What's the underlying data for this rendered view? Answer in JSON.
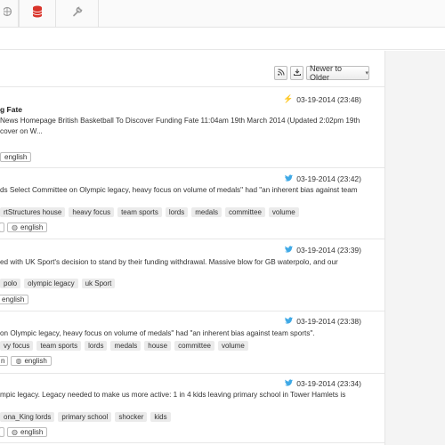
{
  "topbar": {
    "icons": [
      "globe-icon",
      "database-icon",
      "wrench-icon"
    ],
    "accent": "#d9342b"
  },
  "toolbar": {
    "rss_icon": "rss-icon",
    "download_icon": "download-icon",
    "sort_label": "Newer to Older"
  },
  "colors": {
    "twitter": "#3fa9e6",
    "news": "#f3c21a"
  },
  "items": [
    {
      "source": "news",
      "title": "g Fate",
      "timestamp": "03-19-2014 (23:48)",
      "body_line1": "News Homepage British Basketball To Discover Funding Fate 11:04am 19th March 2014 (Updated 2:02pm 19th",
      "body_line2": "cover on W...",
      "tags": [],
      "langs": [
        "english"
      ]
    },
    {
      "source": "twitter",
      "timestamp": "03-19-2014 (23:42)",
      "body_line1": "ds Select Committee on Olympic legacy, heavy focus on volume of medals\" had \"an inherent bias against team",
      "body_line2": "",
      "tags": [
        "rtStructures house",
        "heavy focus",
        "team sports",
        "lords",
        "medals",
        "committee",
        "volume"
      ],
      "langs": [
        "",
        "english"
      ]
    },
    {
      "source": "twitter",
      "timestamp": "03-19-2014 (23:39)",
      "body_line1": "ed with UK Sport's decision to stand by their funding withdrawal. Massive blow for GB waterpolo, and our",
      "body_line2": "",
      "tags": [
        "polo",
        "olympic legacy",
        "uk Sport"
      ],
      "langs": [
        "english"
      ]
    },
    {
      "source": "twitter",
      "timestamp": "03-19-2014 (23:38)",
      "body_line1": "on Olympic legacy, heavy focus on volume of medals\" had \"an inherent bias against team sports\".",
      "body_line2": "",
      "tags": [
        "vy focus",
        "team sports",
        "lords",
        "medals",
        "house",
        "committee",
        "volume"
      ],
      "langs": [
        "n",
        "english"
      ]
    },
    {
      "source": "twitter",
      "timestamp": "03-19-2014 (23:34)",
      "body_line1": "mpic legacy. Legacy needed to make us more active: 1 in 4 kids leaving primary school in Tower Hamlets is",
      "body_line2": "",
      "tags": [
        "ona_King lords",
        "primary school",
        "shocker",
        "kids"
      ],
      "langs": [
        "",
        "english"
      ]
    }
  ]
}
